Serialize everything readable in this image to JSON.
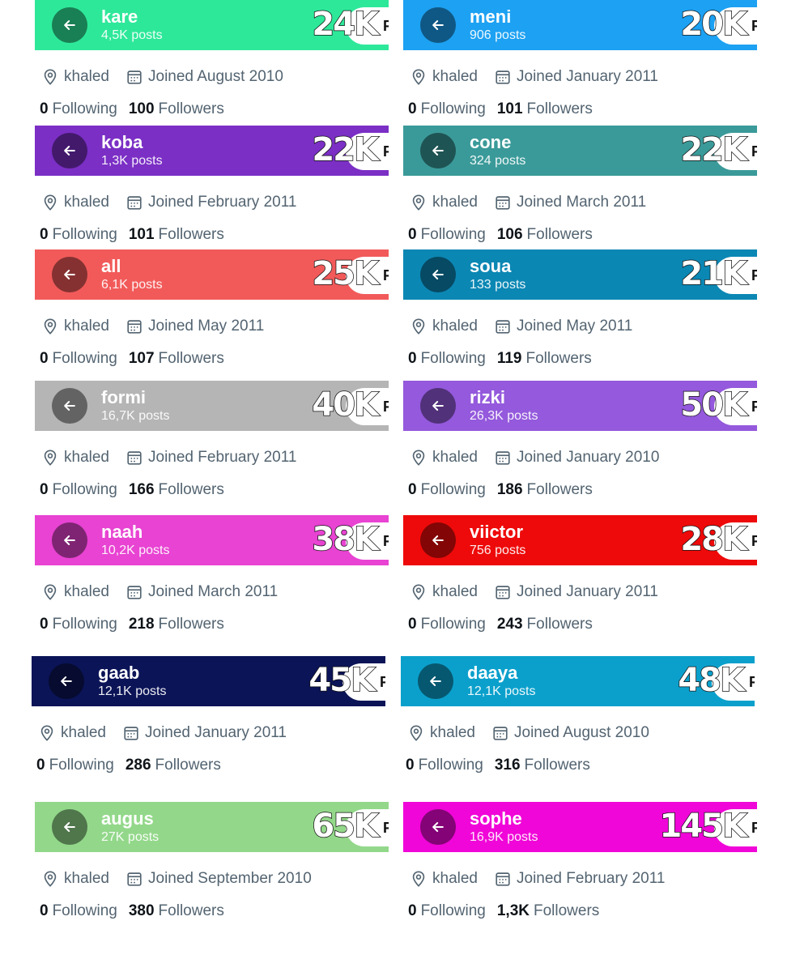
{
  "profiles": [
    {
      "name": "kare",
      "posts": "4,5K posts",
      "big": "24K",
      "pill": "F",
      "color": "#2EE89A",
      "location": "khaled",
      "joined": "Joined August 2010",
      "following_count": "0",
      "following_label": "Following",
      "followers_count": "100",
      "followers_label": "Followers"
    },
    {
      "name": "meni",
      "posts": "906 posts",
      "big": "20K",
      "pill": "F",
      "color": "#1DA1F2",
      "location": "khaled",
      "joined": "Joined January 2011",
      "following_count": "0",
      "following_label": "Following",
      "followers_count": "101",
      "followers_label": "Followers"
    },
    {
      "name": "koba",
      "posts": "1,3K posts",
      "big": "22K",
      "pill": "F",
      "color": "#7B2FC5",
      "location": "khaled",
      "joined": "Joined February 2011",
      "following_count": "0",
      "following_label": "Following",
      "followers_count": "101",
      "followers_label": "Followers"
    },
    {
      "name": "cone",
      "posts": "324 posts",
      "big": "22K",
      "pill": "F",
      "color": "#3A9A99",
      "location": "khaled",
      "joined": "Joined March 2011",
      "following_count": "0",
      "following_label": "Following",
      "followers_count": "106",
      "followers_label": "Followers"
    },
    {
      "name": "all",
      "posts": "6,1K posts",
      "big": "25K",
      "pill": "F",
      "color": "#F25A5A",
      "location": "khaled",
      "joined": "Joined May 2011",
      "following_count": "0",
      "following_label": "Following",
      "followers_count": "107",
      "followers_label": "Followers"
    },
    {
      "name": "soua",
      "posts": "133 posts",
      "big": "21K",
      "pill": "F",
      "color": "#0B87B4",
      "location": "khaled",
      "joined": "Joined May 2011",
      "following_count": "0",
      "following_label": "Following",
      "followers_count": "119",
      "followers_label": "Followers"
    },
    {
      "name": "formi",
      "posts": "16,7K posts",
      "big": "40K",
      "pill": "F",
      "color": "#B5B5B5",
      "location": "khaled",
      "joined": "Joined February 2011",
      "following_count": "0",
      "following_label": "Following",
      "followers_count": "166",
      "followers_label": "Followers"
    },
    {
      "name": "rizki",
      "posts": "26,3K posts",
      "big": "50K",
      "pill": "F",
      "color": "#9459DC",
      "location": "khaled",
      "joined": "Joined January 2010",
      "following_count": "0",
      "following_label": "Following",
      "followers_count": "186",
      "followers_label": "Followers"
    },
    {
      "name": "naah",
      "posts": "10,2K posts",
      "big": "38K",
      "pill": "F",
      "color": "#E843D2",
      "location": "khaled",
      "joined": "Joined March 2011",
      "following_count": "0",
      "following_label": "Following",
      "followers_count": "218",
      "followers_label": "Followers"
    },
    {
      "name": "viictor",
      "posts": "756 posts",
      "big": "28K",
      "pill": "F",
      "color": "#EE0A0A",
      "location": "khaled",
      "joined": "Joined January 2011",
      "following_count": "0",
      "following_label": "Following",
      "followers_count": "243",
      "followers_label": "Followers"
    },
    {
      "name": "gaab",
      "posts": "12,1K posts",
      "big": "45K",
      "pill": "F",
      "color": "#0B1457",
      "location": "khaled",
      "joined": "Joined January 2011",
      "following_count": "0",
      "following_label": "Following",
      "followers_count": "286",
      "followers_label": "Followers"
    },
    {
      "name": "daaya",
      "posts": "12,1K posts",
      "big": "48K",
      "pill": "F",
      "color": "#0BA0CC",
      "location": "khaled",
      "joined": "Joined August 2010",
      "following_count": "0",
      "following_label": "Following",
      "followers_count": "316",
      "followers_label": "Followers"
    },
    {
      "name": "augus",
      "posts": "27K posts",
      "big": "65K",
      "pill": "F",
      "color": "#93D88A",
      "location": "khaled",
      "joined": "Joined September 2010",
      "following_count": "0",
      "following_label": "Following",
      "followers_count": "380",
      "followers_label": "Followers"
    },
    {
      "name": "sophe",
      "posts": "16,9K posts",
      "big": "145K",
      "pill": "F",
      "color": "#F006D8",
      "location": "khaled",
      "joined": "Joined February 2011",
      "following_count": "0",
      "following_label": "Following",
      "followers_count": "1,3K",
      "followers_label": "Followers"
    }
  ]
}
